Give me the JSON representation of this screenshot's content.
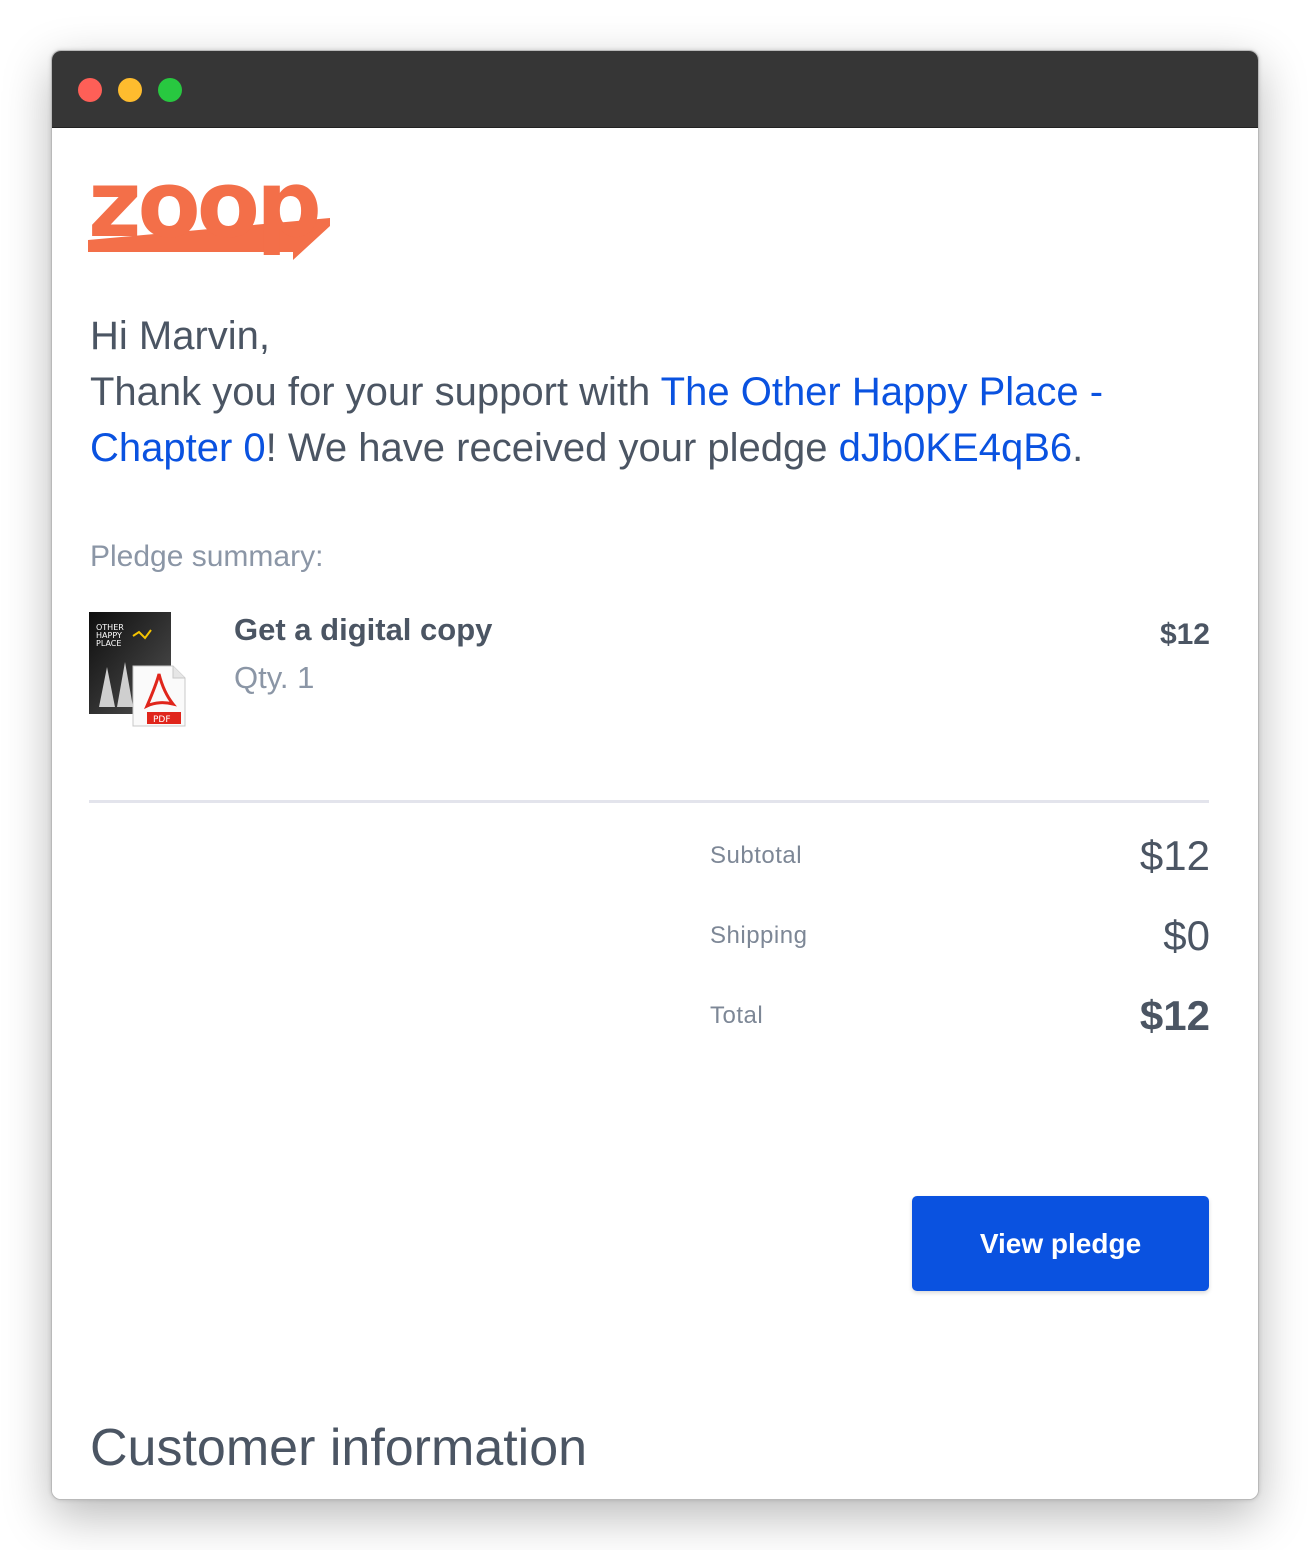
{
  "brand": {
    "logo_text": "zoop",
    "logo_color": "#f36f49"
  },
  "email": {
    "greeting": "Hi Marvin,",
    "thanks_prefix": "Thank you for your support with ",
    "project_link": "The Other Happy Place - Chapter 0",
    "thanks_mid": "! We have received your pledge ",
    "pledge_id": "dJb0KE4qB6",
    "thanks_suffix": "."
  },
  "summary": {
    "label": "Pledge summary:",
    "item": {
      "title": "Get a digital copy",
      "qty": "Qty. 1",
      "price": "$12",
      "cover_text": "OTHER HAPPY PLACE",
      "file_badge": "PDF"
    }
  },
  "totals": {
    "subtotal_label": "Subtotal",
    "subtotal_value": "$12",
    "shipping_label": "Shipping",
    "shipping_value": "$0",
    "total_label": "Total",
    "total_value": "$12"
  },
  "actions": {
    "view_pledge_label": "View pledge"
  },
  "sections": {
    "customer_info_title": "Customer information"
  },
  "colors": {
    "link": "#0a52e0",
    "button": "#0a52e0",
    "text": "#4b5563",
    "muted": "#8b96a6"
  }
}
